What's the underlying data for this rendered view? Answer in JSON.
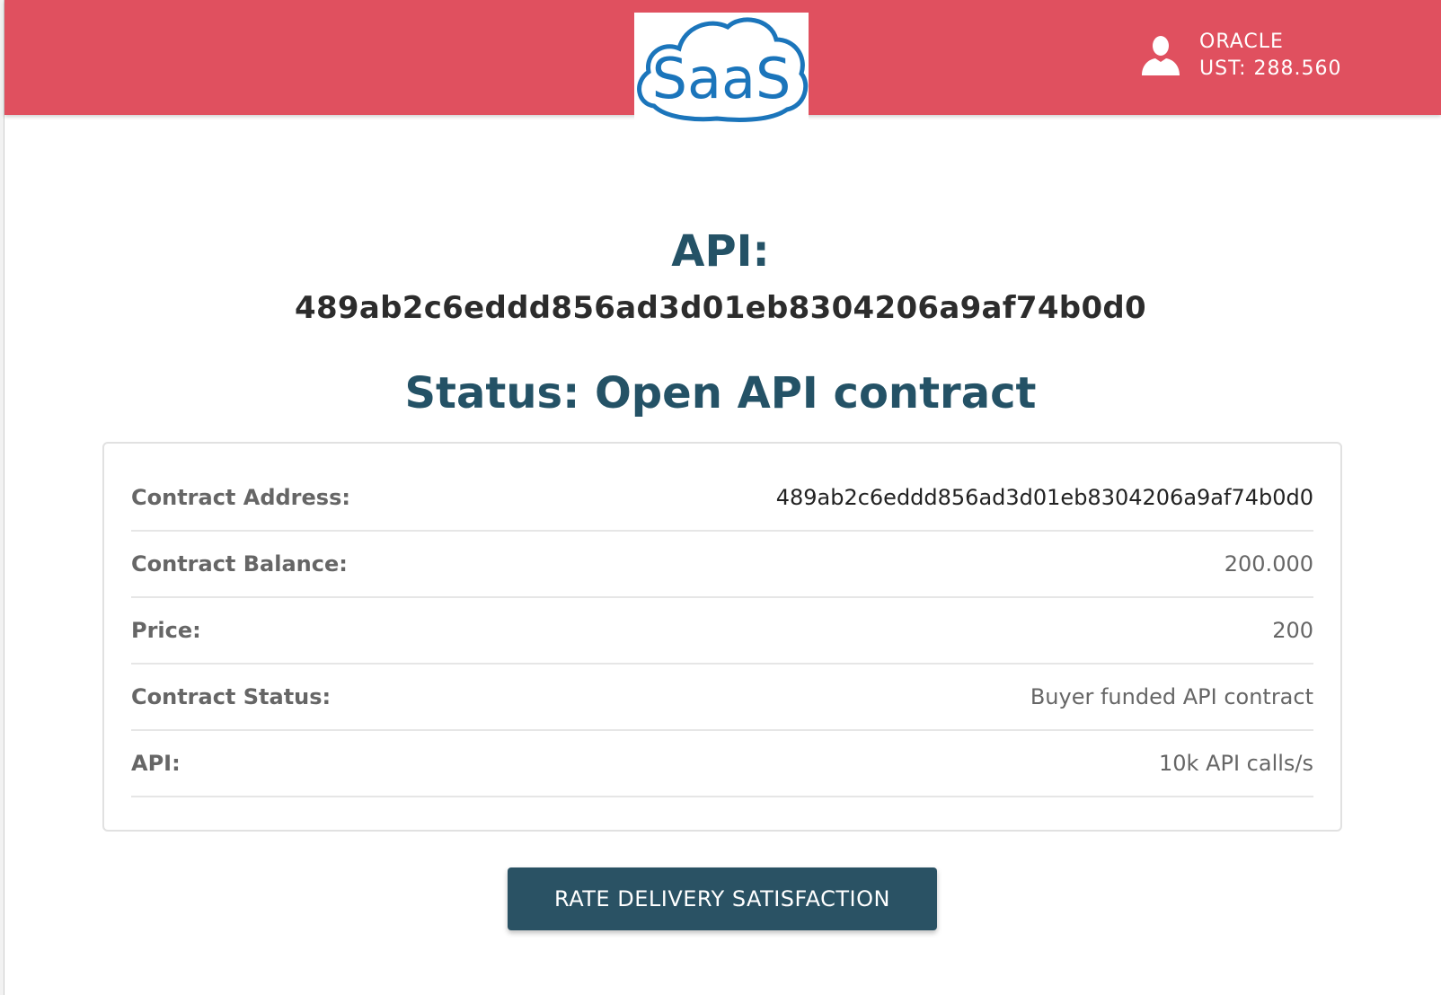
{
  "header": {
    "logo_text": "SaaS",
    "user": {
      "name": "ORACLE",
      "balance": "UST: 288.560",
      "icon": "user-icon"
    },
    "color": "#e0505f"
  },
  "main": {
    "api_title": "API:",
    "api_id": "489ab2c6eddd856ad3d01eb8304206a9af74b0d0",
    "status_title": "Status: Open API contract",
    "details": [
      {
        "label": "Contract Address:",
        "value": "489ab2c6eddd856ad3d01eb8304206a9af74b0d0"
      },
      {
        "label": "Contract Balance:",
        "value": "200.000"
      },
      {
        "label": "Price:",
        "value": "200"
      },
      {
        "label": "Contract Status:",
        "value": "Buyer funded API contract"
      },
      {
        "label": "API:",
        "value": "10k API calls/s"
      }
    ],
    "action_label": "RATE DELIVERY SATISFACTION"
  },
  "colors": {
    "title": "#245266",
    "button": "#2a5264",
    "logo": "#1b75bb"
  }
}
